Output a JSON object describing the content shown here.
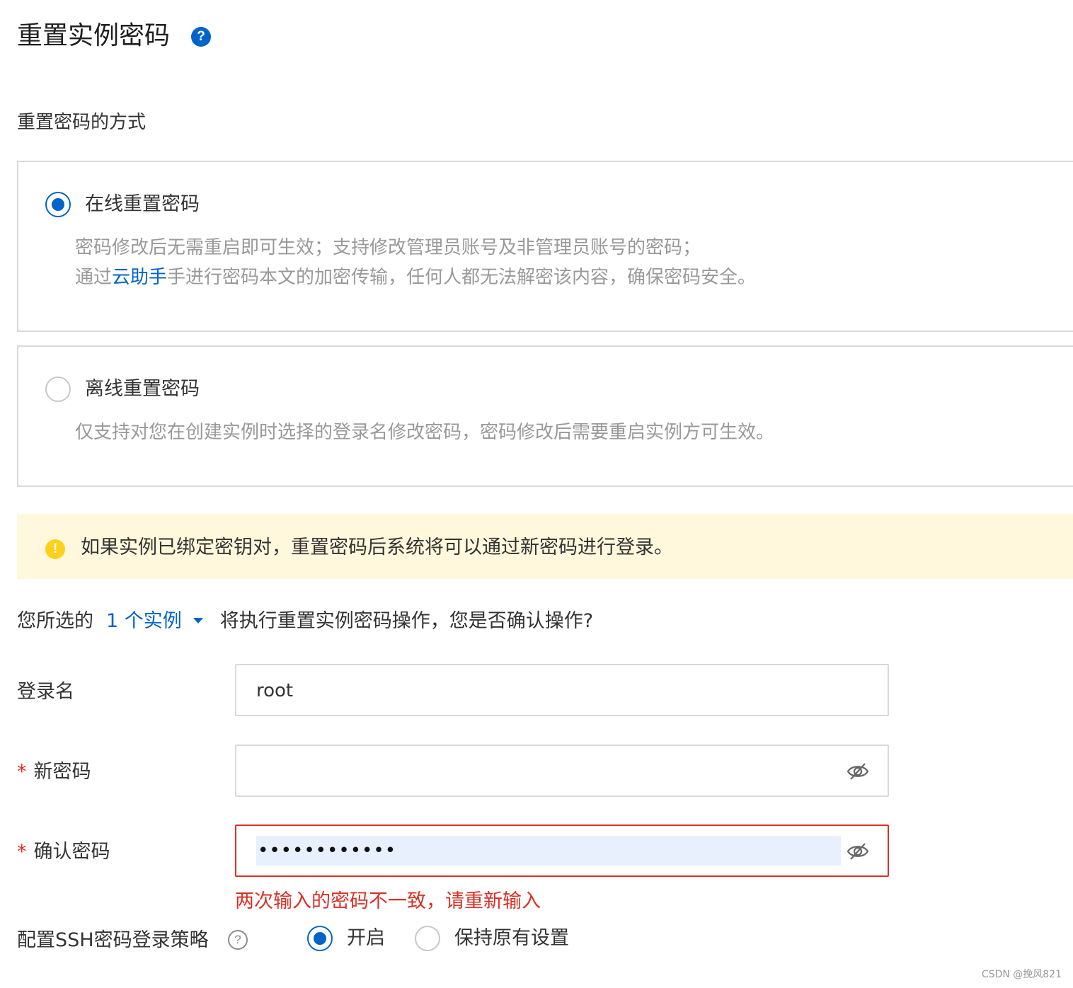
{
  "page": {
    "title": "重置实例密码",
    "help_icon": "question-circle-filled"
  },
  "reset_method": {
    "label": "重置密码的方式",
    "options": [
      {
        "label": "在线重置密码",
        "selected": true,
        "desc_line1": "密码修改后无需重启即可生效；支持修改管理员账号及非管理员账号的密码；",
        "desc_line2_prefix": "通过",
        "desc_line2_link": "云助手",
        "desc_line2_suffix": "手进行密码本文的加密传输，任何人都无法解密该内容，确保密码安全。"
      },
      {
        "label": "离线重置密码",
        "selected": false,
        "desc_line1": "仅支持对您在创建实例时选择的登录名修改密码，密码修改后需要重启实例方可生效。"
      }
    ]
  },
  "notice": {
    "icon": "warning-circle-icon",
    "text": "如果实例已绑定密钥对，重置密码后系统将可以通过新密码进行登录。"
  },
  "confirm": {
    "prefix": "您所选的",
    "instances_link": "1 个实例",
    "suffix": "将执行重置实例密码操作，您是否确认操作?"
  },
  "form": {
    "login_name": {
      "label": "登录名",
      "value": "root"
    },
    "new_password": {
      "required_mark": "*",
      "label": "新密码",
      "value": ""
    },
    "confirm_password": {
      "required_mark": "*",
      "label": "确认密码",
      "masked_value": "••••••••••••"
    },
    "error_message": "两次输入的密码不一致，请重新输入"
  },
  "ssh_policy": {
    "label": "配置SSH密码登录策略",
    "help_icon": "question-circle-outline",
    "options": [
      {
        "label": "开启",
        "selected": true
      },
      {
        "label": "保持原有设置",
        "selected": false
      }
    ]
  },
  "watermark": "CSDN @挽风821",
  "colors": {
    "primary": "#0064c8",
    "error": "#d93026",
    "warning_bg": "#fff8dc",
    "warning_icon": "#ffd11a",
    "autofill_bg": "#e8f0fe"
  }
}
